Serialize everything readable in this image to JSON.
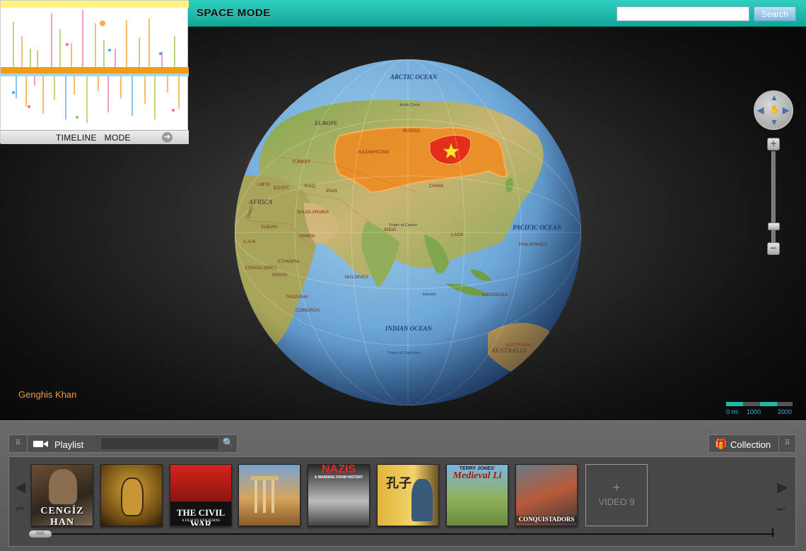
{
  "header": {
    "mode_title": "SPACE  MODE",
    "search_placeholder": "",
    "search_button": "Search"
  },
  "timeline": {
    "label": "TIMELINE   MODE",
    "arrow_icon": "arrow-right-icon"
  },
  "globe": {
    "labels": {
      "arctic_ocean": "ARCTIC OCEAN",
      "pacific_ocean": "PACIFIC OCEAN",
      "indian_ocean": "INDIAN OCEAN",
      "europe": "EUROPE",
      "africa": "AFRICA",
      "australia": "AUSTRALIA",
      "russia": "RUSSIA",
      "kazakhstan": "KAZAKHSTAN",
      "china": "CHINA",
      "india": "INDIA",
      "iran": "IRAN",
      "iraq": "IRAQ",
      "turkey": "TURKEY",
      "egypt": "EGYPT",
      "libya": "LIBYA",
      "algeria": "ALGERIA",
      "chad": "CHAD",
      "sudan": "SUDAN",
      "saudi_arabia": "SAUDI ARABIA",
      "yemen": "YEMEN",
      "car": "C.A.R.",
      "congo": "CONGO (DRC)",
      "ethiopia": "ETHIOPIA",
      "kenya": "KENYA",
      "tanzania": "TANZANIA",
      "comoros": "COMOROS",
      "maldives": "MALDIVES",
      "laos": "LAOS",
      "philippines": "PHILIPPINES",
      "indonesia": "INDONESIA",
      "australia_country": "AUSTRALIA",
      "arctic_circle": "Arctic Circle",
      "tropic_cancer": "Tropic of Cancer",
      "tropic_capricorn": "Tropic of Capricorn",
      "equator": "Equator"
    }
  },
  "controls": {
    "zoom_in": "+",
    "zoom_out": "−",
    "zoom_level": 0.2
  },
  "person_label": "Genghis Khan",
  "scale": {
    "labels": [
      "0 mi",
      "1000",
      "2000"
    ],
    "colors": [
      "#1fb8ad",
      "#555555",
      "#1fb8ad",
      "#555555"
    ]
  },
  "playlist": {
    "label": "Playlist",
    "search_placeholder": ""
  },
  "collection": {
    "label": "Collection"
  },
  "thumbnails": [
    {
      "id": "cengiz-han",
      "caption": "CENGİZ HAN"
    },
    {
      "id": "pharaoh",
      "caption": ""
    },
    {
      "id": "civil-war",
      "caption": "THE CIVIL WAR",
      "sub": "A FILM BY KEN BURNS"
    },
    {
      "id": "roman-forum",
      "caption": ""
    },
    {
      "id": "nazis",
      "caption": "NAZIS",
      "sub": "A WARNING FROM HISTORY"
    },
    {
      "id": "confucius",
      "caption": ""
    },
    {
      "id": "medieval-lives",
      "caption": "Medieval Li",
      "sub": "TERRY JONES'"
    },
    {
      "id": "conquistadors",
      "caption": "CONQUISTADORS"
    }
  ],
  "video_placeholder": {
    "plus": "+",
    "label": "VIDEO 9"
  },
  "carousel": {
    "scroll_thumb_label": "IIIIII"
  }
}
